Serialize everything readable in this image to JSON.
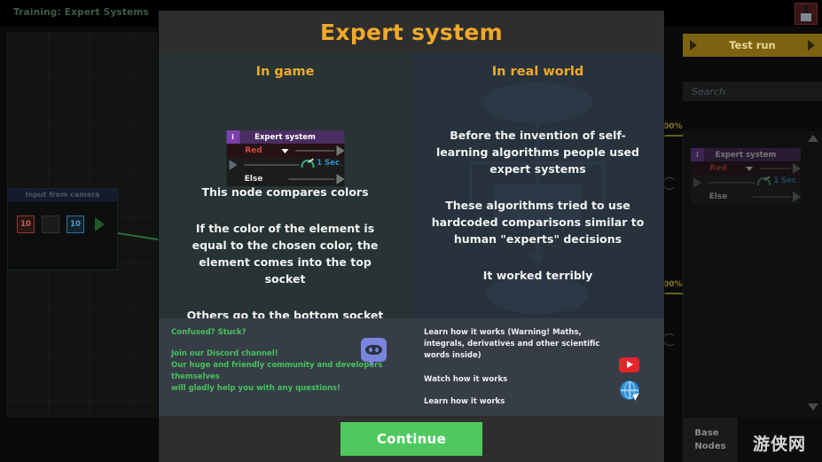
{
  "game": {
    "training_title": "Training: Expert\nSystems",
    "camera_node": {
      "title": "Input from camera",
      "values": [
        "10",
        "",
        "10"
      ]
    },
    "test_run_label": "Test run",
    "search_placeholder": "Search",
    "base_nodes_tab": "Base\nNodes",
    "watermark": "游侠网",
    "progress_labels": [
      "00%",
      "00%"
    ],
    "sidebar_node": {
      "info_badge": "i",
      "title": "Expert system",
      "condition": "Red",
      "timer": "1 Sec",
      "else_label": "Else"
    }
  },
  "modal": {
    "title": "Expert system",
    "left": {
      "heading": "In game",
      "node": {
        "info_badge": "i",
        "title": "Expert system",
        "condition": "Red",
        "timer": "1 Sec",
        "else_label": "Else"
      },
      "paragraphs": [
        "This node compares colors",
        "If the color of the element is equal to the chosen color, the element comes into the top socket",
        "Others go to the bottom socket"
      ]
    },
    "right": {
      "heading": "In real world",
      "paragraphs": [
        "Before the invention of self-learning algorithms people used expert systems",
        "These algorithms tried to use hardcoded comparisons similar to human \"experts\" decisions",
        "It worked terribly"
      ]
    },
    "footer_left": {
      "headline": "Confused? Stuck?",
      "line1": "Join our Discord channel!",
      "line2": "Our huge and friendly community and developers themselves",
      "line3": "will gladly help you with any questions!",
      "icon": "discord-icon"
    },
    "footer_right": {
      "link1": "Learn how it works (Warning! Maths, integrals, derivatives and other scientific words inside)",
      "link2": "Watch how it works",
      "link3": "Learn how it works",
      "icon2": "youtube-icon",
      "icon3": "globe-icon"
    },
    "continue_label": "Continue"
  },
  "colors": {
    "accent_gold": "#f0a92b",
    "panel_left": "#283434",
    "panel_right": "#27323d",
    "footer": "#373d47",
    "continue_green": "#4fc95f",
    "discord_text": "#46c25c"
  }
}
